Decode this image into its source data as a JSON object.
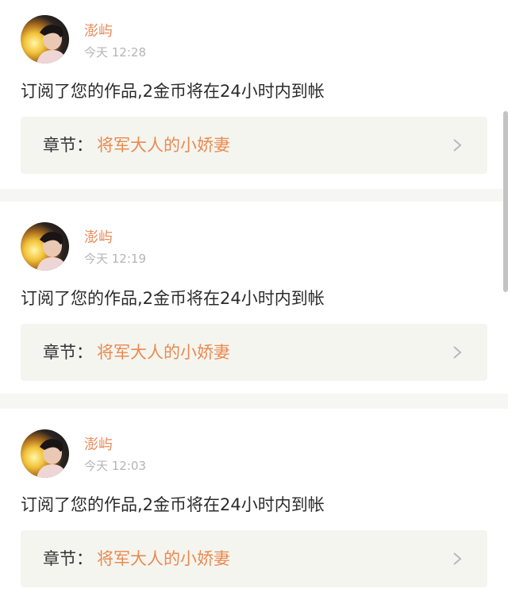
{
  "notifications": [
    {
      "username": "澎屿",
      "timestamp": "今天 12:28",
      "message": "订阅了您的作品,2金币将在24小时内到帐",
      "chapter_label": "章节：",
      "chapter_title": "将军大人的小娇妻"
    },
    {
      "username": "澎屿",
      "timestamp": "今天 12:19",
      "message": "订阅了您的作品,2金币将在24小时内到帐",
      "chapter_label": "章节：",
      "chapter_title": "将军大人的小娇妻"
    },
    {
      "username": "澎屿",
      "timestamp": "今天 12:03",
      "message": "订阅了您的作品,2金币将在24小时内到帐",
      "chapter_label": "章节：",
      "chapter_title": "将军大人的小娇妻"
    }
  ],
  "colors": {
    "username": "#e88b5a",
    "chapter_title": "#ea8a4f",
    "timestamp": "#b5b5b5",
    "chapter_box_bg": "#f5f5f0",
    "divider": "#f6f6f4"
  },
  "icons": {
    "avatar": "user-avatar-image",
    "chevron": "chevron-right-icon"
  }
}
